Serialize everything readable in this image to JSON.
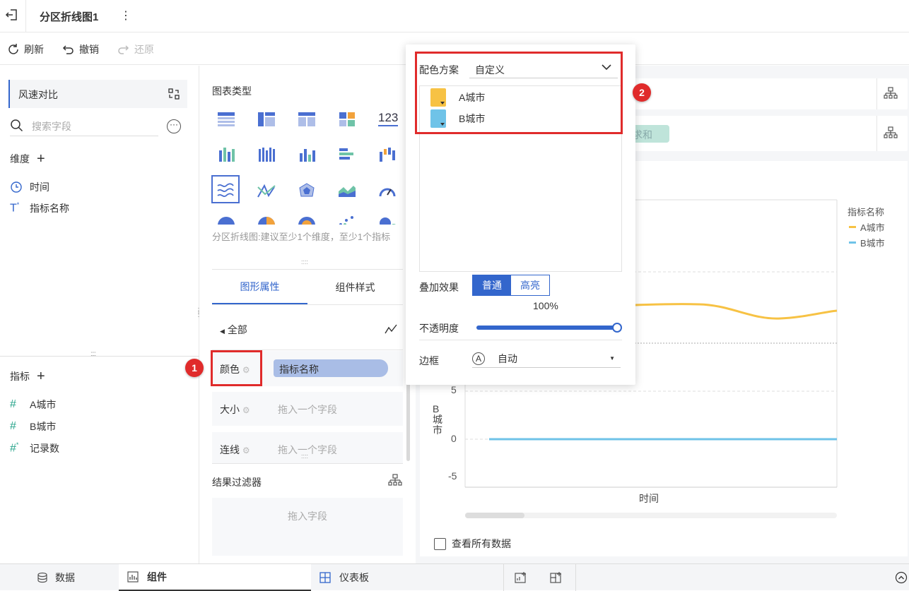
{
  "topbar": {
    "title": "分区折线图1",
    "more": "⋮"
  },
  "toolbar": {
    "refresh": "刷新",
    "undo": "撤销",
    "redo": "还原"
  },
  "left": {
    "dataset": "风速对比",
    "search_placeholder": "搜索字段",
    "dim_header": "维度",
    "dims": [
      "时间",
      "指标名称"
    ],
    "metric_header": "指标",
    "metrics": [
      "A城市",
      "B城市",
      "记录数"
    ]
  },
  "mid": {
    "chart_type_label": "图表类型",
    "kpi_icon": "123",
    "hint": "分区折线图:建议至少1个维度，至少1个指标",
    "tabs": [
      "图形属性",
      "组件样式"
    ],
    "all_label": "全部",
    "color_label": "颜色",
    "color_field": "指标名称",
    "size_label": "大小",
    "size_placeholder": "拖入一个字段",
    "line_label": "连线",
    "line_placeholder": "拖入一个字段",
    "filter_label": "结果过滤器",
    "filter_placeholder": "拖入字段"
  },
  "chart": {
    "partial_tag": "求和",
    "legend_title": "指标名称",
    "legend": [
      "A城市",
      "B城市"
    ],
    "y_ticks": [
      "5",
      "0",
      "-5"
    ],
    "y_label": "B城市",
    "x_label": "时间",
    "view_all": "查看所有数据",
    "colors": {
      "a": "#f7c244",
      "b": "#6fc3e8"
    }
  },
  "popup": {
    "scheme_label": "配色方案",
    "scheme_value": "自定义",
    "items": [
      {
        "name": "A城市",
        "color": "#f7c244"
      },
      {
        "name": "B城市",
        "color": "#6fc3e8"
      }
    ],
    "blend_label": "叠加效果",
    "blend_options": [
      "普通",
      "高亮"
    ],
    "opacity_value": "100%",
    "opacity_label": "不透明度",
    "border_label": "边框",
    "border_value": "自动"
  },
  "annotations": {
    "badge1": "1",
    "badge2": "2"
  },
  "bottom": {
    "data": "数据",
    "component": "组件",
    "dashboard": "仪表板"
  }
}
